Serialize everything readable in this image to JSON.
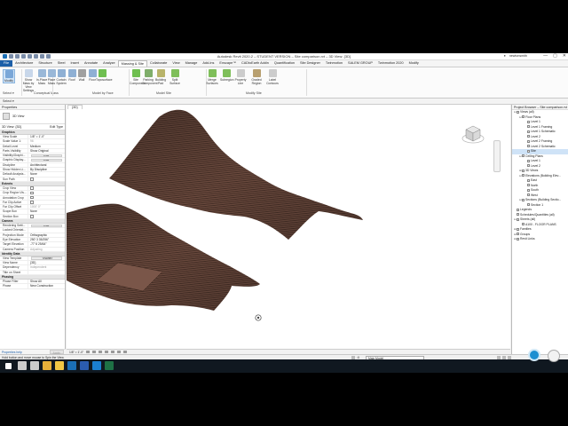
{
  "app": {
    "title": "Autodesk Revit 2020.2 – STUDENT VERSION – Site comparison.rvt – 3D View: {3D}",
    "user": "newtonsmith",
    "window_controls": [
      "—",
      "▢",
      "✕"
    ]
  },
  "ribbon": {
    "file_tab": "File",
    "tabs": [
      "Architecture",
      "Structure",
      "Steel",
      "Insert",
      "Annotate",
      "Analyze",
      "Massing & Site",
      "Collaborate",
      "View",
      "Manage",
      "Add-Ins",
      "Enscape™",
      "CADtoEarth Addin",
      "Quantification",
      "Site Designer",
      "Twinmotion",
      "SALEM GROUP",
      "Twinmotion 2020",
      "Modify"
    ],
    "active_tab": "Massing & Site",
    "tools": [
      {
        "label": "Modify",
        "icon": "modify-arrow-icon",
        "color": "#7aa7d8"
      },
      {
        "label": "Show Mass by View Settings",
        "icon": "show-mass-icon",
        "color": "#c8d7ea"
      },
      {
        "label": "In-Place Mass",
        "icon": "in-place-mass-icon",
        "color": "#9ab8d8"
      },
      {
        "label": "Place Mass",
        "icon": "place-mass-icon",
        "color": "#9ab8d8"
      },
      {
        "label": "Curtain System",
        "icon": "curtain-system-icon",
        "color": "#8fb0d4"
      },
      {
        "label": "Roof",
        "icon": "roof-icon",
        "color": "#8fb0d4"
      },
      {
        "label": "Wall",
        "icon": "wall-icon",
        "color": "#a0a0a0"
      },
      {
        "label": "Floor",
        "icon": "floor-icon",
        "color": "#8fb0d4"
      },
      {
        "label": "Toposurface",
        "icon": "toposurface-icon",
        "color": "#6fbf50"
      },
      {
        "label": "Site Component",
        "icon": "site-component-icon",
        "color": "#6fbf50"
      },
      {
        "label": "Parking Component",
        "icon": "parking-component-icon",
        "color": "#7fae6a"
      },
      {
        "label": "Building Pad",
        "icon": "building-pad-icon",
        "color": "#b9b46a"
      },
      {
        "label": "Split Surface",
        "icon": "split-surface-icon",
        "color": "#7fbf5a"
      },
      {
        "label": "Merge Surfaces",
        "icon": "merge-surfaces-icon",
        "color": "#7fbf5a"
      },
      {
        "label": "Subregion",
        "icon": "subregion-icon",
        "color": "#7fbf5a"
      },
      {
        "label": "Property Line",
        "icon": "property-line-icon",
        "color": "#cccccc"
      },
      {
        "label": "Graded Region",
        "icon": "graded-region-icon",
        "color": "#b8a070"
      },
      {
        "label": "Label Contours",
        "icon": "label-contours-icon",
        "color": "#cccccc"
      }
    ],
    "panels": [
      "Select ▾",
      "Conceptual Mass",
      "Model by Face",
      "Model Site",
      "Modify Site"
    ]
  },
  "modify_bar": "Select ▾",
  "properties": {
    "header": "Properties",
    "type_name": "3D View",
    "filter": "3D View: {3D}",
    "edit_type": "Edit Type",
    "sections": [
      {
        "title": "Graphics",
        "rows": [
          {
            "k": "View Scale",
            "v": "1/8\" = 1'-0\""
          },
          {
            "k": "Scale Value 1:",
            "v": "96",
            "grey": true
          },
          {
            "k": "Detail Level",
            "v": "Medium"
          },
          {
            "k": "Parts Visibility",
            "v": "Show Original"
          },
          {
            "k": "Visibility/Graphi...",
            "v": "Edit...",
            "btn": true
          },
          {
            "k": "Graphic Display...",
            "v": "Edit...",
            "btn": true
          },
          {
            "k": "Discipline",
            "v": "Architectural"
          },
          {
            "k": "Show Hidden Li...",
            "v": "By Discipline"
          },
          {
            "k": "Default Analysis...",
            "v": "None"
          },
          {
            "k": "Sun Path",
            "cb": true
          }
        ]
      },
      {
        "title": "Extents",
        "rows": [
          {
            "k": "Crop View",
            "cb": true
          },
          {
            "k": "Crop Region Vis...",
            "cb": true
          },
          {
            "k": "Annotation Crop",
            "cb": true
          },
          {
            "k": "Far Clip Active",
            "cb": true
          },
          {
            "k": "Far Clip Offset",
            "v": "1000' 0\"",
            "grey": true
          },
          {
            "k": "Scope Box",
            "v": "None"
          },
          {
            "k": "Section Box",
            "cb": true
          }
        ]
      },
      {
        "title": "Camera",
        "rows": [
          {
            "k": "Rendering Setti...",
            "v": "Edit...",
            "btn": true
          },
          {
            "k": "Locked Orientat...",
            "v": "",
            "grey": true
          },
          {
            "k": "Projection Mode",
            "v": "Orthographic"
          },
          {
            "k": "Eye Elevation",
            "v": "250' 3 35/256\""
          },
          {
            "k": "Target Elevation",
            "v": "-77' 6 25/64\""
          },
          {
            "k": "Camera Position",
            "v": "Adjusting",
            "grey": true
          }
        ]
      },
      {
        "title": "Identity Data",
        "rows": [
          {
            "k": "View Template",
            "v": "<None>",
            "btn": true
          },
          {
            "k": "View Name",
            "v": "{3D}"
          },
          {
            "k": "Dependency",
            "v": "Independent",
            "grey": true
          },
          {
            "k": "Title on Sheet",
            "v": ""
          }
        ]
      },
      {
        "title": "Phasing",
        "rows": [
          {
            "k": "Phase Filter",
            "v": "Show All"
          },
          {
            "k": "Phase",
            "v": "New Construction"
          }
        ]
      }
    ],
    "help_link": "Properties help",
    "apply": "Apply"
  },
  "view": {
    "tab": "{3D}",
    "scale": "1/8\" = 1'-0\"",
    "terrain_color": "#6b4a3e",
    "contour_color": "#2e1d17"
  },
  "browser": {
    "header": "Project Browser – Site comparison.rvt",
    "items": [
      {
        "label": "Views (all)",
        "lvl": 0,
        "tg": "⊟"
      },
      {
        "label": "Floor Plans",
        "lvl": 1,
        "tg": "⊟"
      },
      {
        "label": "Level 1",
        "lvl": 2
      },
      {
        "label": "Level 1 Framing",
        "lvl": 2
      },
      {
        "label": "Level 1 Schematic",
        "lvl": 2
      },
      {
        "label": "Level 2",
        "lvl": 2
      },
      {
        "label": "Level 2 Framing",
        "lvl": 2
      },
      {
        "label": "Level 2 Schematic",
        "lvl": 2
      },
      {
        "label": "Site",
        "lvl": 2,
        "sel": true
      },
      {
        "label": "Ceiling Plans",
        "lvl": 1,
        "tg": "⊟"
      },
      {
        "label": "Level 1",
        "lvl": 2
      },
      {
        "label": "Level 2",
        "lvl": 2
      },
      {
        "label": "3D Views",
        "lvl": 1,
        "tg": "⊞"
      },
      {
        "label": "Elevations (Building Elev...",
        "lvl": 1,
        "tg": "⊟"
      },
      {
        "label": "East",
        "lvl": 2
      },
      {
        "label": "North",
        "lvl": 2
      },
      {
        "label": "South",
        "lvl": 2
      },
      {
        "label": "West",
        "lvl": 2
      },
      {
        "label": "Sections (Building Sectio...",
        "lvl": 1,
        "tg": "⊟"
      },
      {
        "label": "Section 1",
        "lvl": 2
      },
      {
        "label": "Legends",
        "lvl": 0
      },
      {
        "label": "Schedules/Quantities (all)",
        "lvl": 0
      },
      {
        "label": "Sheets (all)",
        "lvl": 0,
        "tg": "⊟"
      },
      {
        "label": "A100 - FLOOR PLANS",
        "lvl": 1
      },
      {
        "label": "Families",
        "lvl": 0,
        "tg": "⊞"
      },
      {
        "label": "Groups",
        "lvl": 0,
        "tg": "⊞"
      },
      {
        "label": "Revit Links",
        "lvl": 0,
        "tg": "⊞"
      }
    ]
  },
  "status": {
    "text": "Hold button and move mouse to Spin the View.",
    "model": "Main Model",
    "zero": ":0"
  },
  "taskbar": {
    "icons": [
      {
        "name": "windows-start-icon",
        "color": "#ffffff"
      },
      {
        "name": "search-icon",
        "color": "#cccccc"
      },
      {
        "name": "task-view-icon",
        "color": "#cccccc"
      },
      {
        "name": "chrome-icon",
        "color": "#e8b03a"
      },
      {
        "name": "file-explorer-icon",
        "color": "#f2c744"
      },
      {
        "name": "revit-icon",
        "color": "#1b6fb5"
      },
      {
        "name": "word-icon",
        "color": "#2b5cb0"
      },
      {
        "name": "outlook-icon",
        "color": "#1b7fd0"
      },
      {
        "name": "excel-icon",
        "color": "#1e7145"
      }
    ]
  }
}
